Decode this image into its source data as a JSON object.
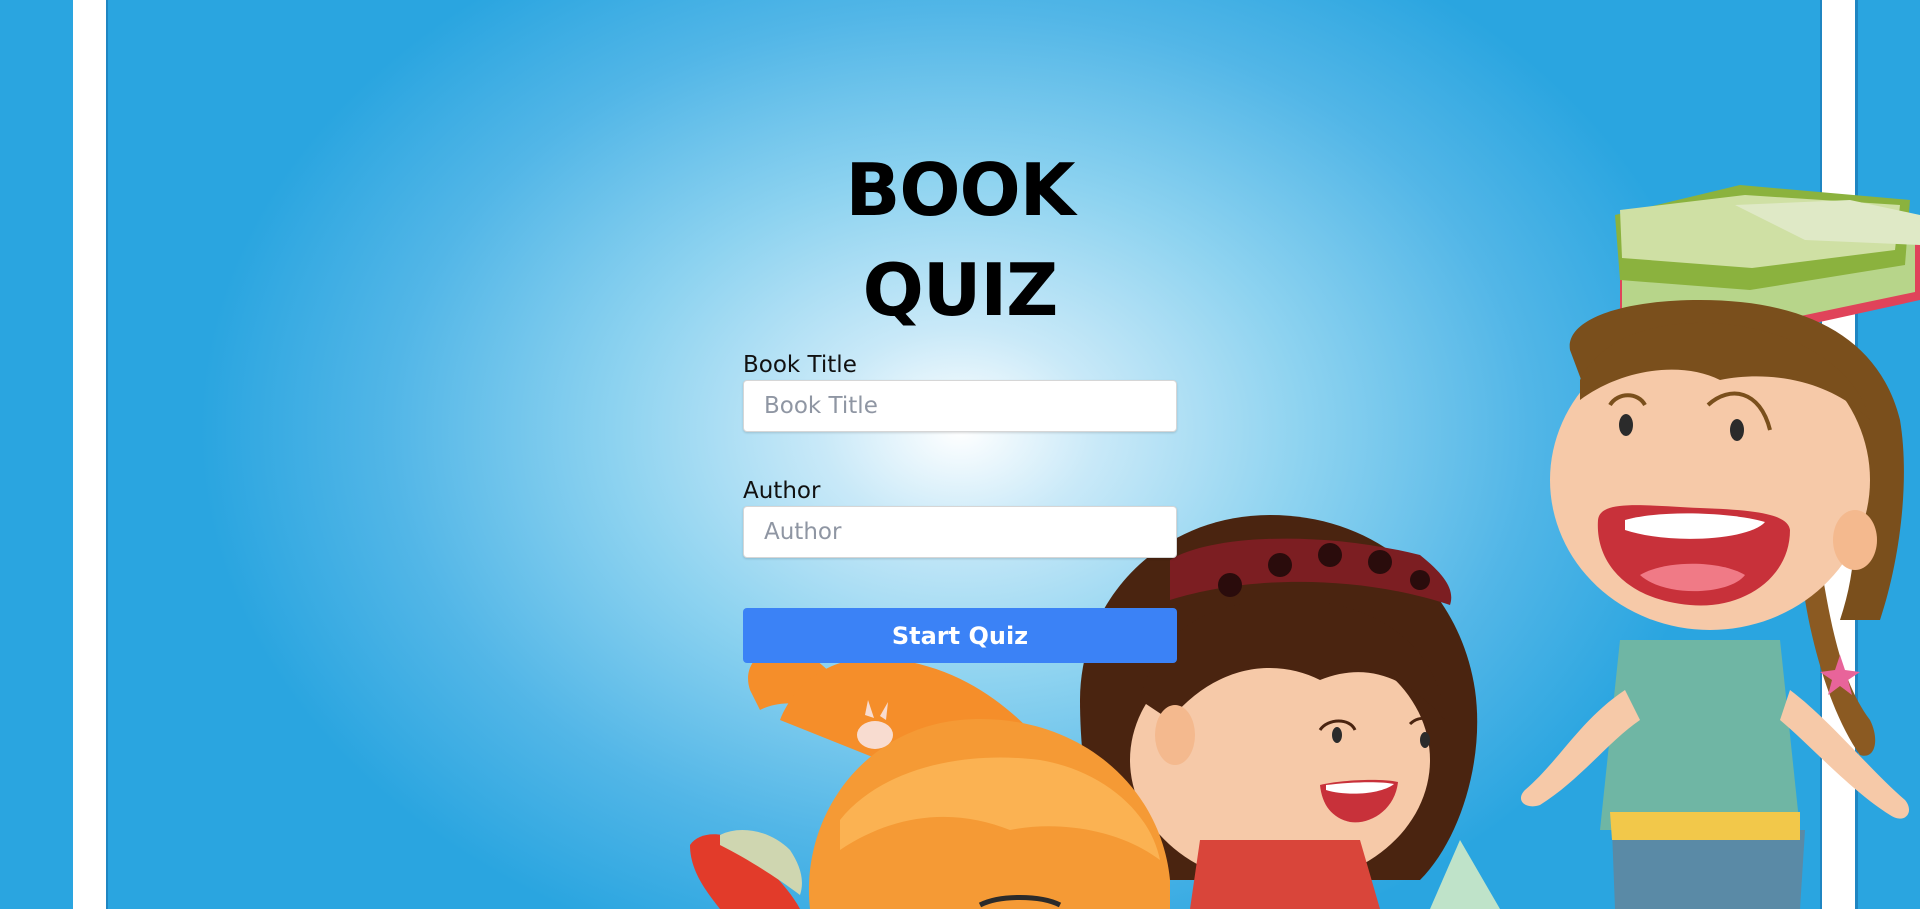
{
  "page": {
    "title": "BOOK QUIZ"
  },
  "form": {
    "book_title_label": "Book Title",
    "book_title_placeholder": "Book Title",
    "book_title_value": "",
    "author_label": "Author",
    "author_placeholder": "Author",
    "author_value": "",
    "submit_label": "Start Quiz"
  },
  "colors": {
    "background_center": "#ffffff",
    "background_edge": "#2aa5e0",
    "button": "#3b82f6",
    "stripe": "#ffffff"
  },
  "icons": {
    "illustration": "children-reading-books-illustration"
  }
}
